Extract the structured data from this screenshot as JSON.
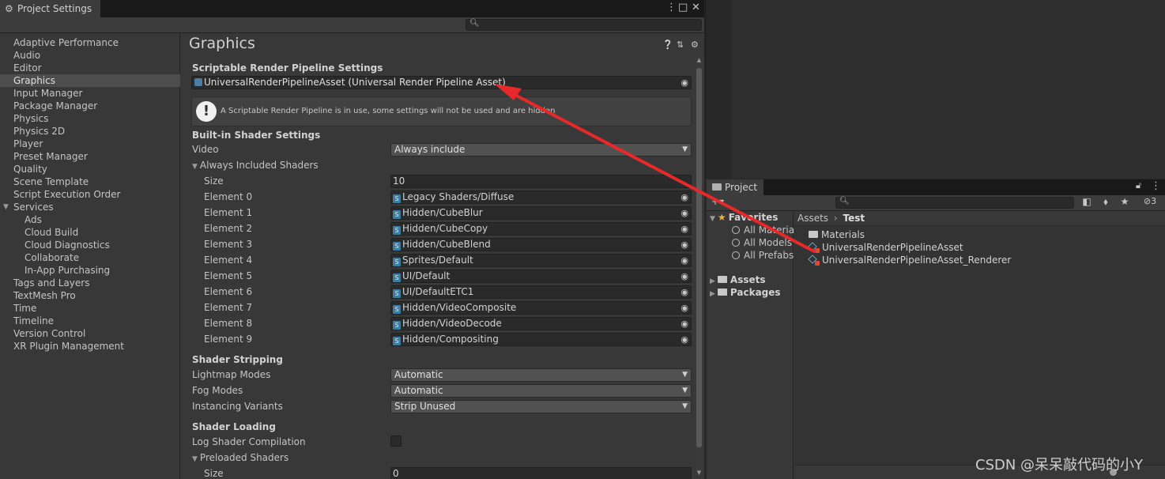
{
  "project_settings": {
    "tab_title": "Project Settings",
    "page_title": "Graphics",
    "sidebar": [
      {
        "label": "Adaptive Performance"
      },
      {
        "label": "Audio"
      },
      {
        "label": "Editor"
      },
      {
        "label": "Graphics",
        "selected": true
      },
      {
        "label": "Input Manager"
      },
      {
        "label": "Package Manager"
      },
      {
        "label": "Physics"
      },
      {
        "label": "Physics 2D"
      },
      {
        "label": "Player"
      },
      {
        "label": "Preset Manager"
      },
      {
        "label": "Quality"
      },
      {
        "label": "Scene Template"
      },
      {
        "label": "Script Execution Order"
      },
      {
        "label": "Services",
        "expandable": true
      },
      {
        "label": "Ads",
        "child": true
      },
      {
        "label": "Cloud Build",
        "child": true
      },
      {
        "label": "Cloud Diagnostics",
        "child": true
      },
      {
        "label": "Collaborate",
        "child": true
      },
      {
        "label": "In-App Purchasing",
        "child": true
      },
      {
        "label": "Tags and Layers"
      },
      {
        "label": "TextMesh Pro"
      },
      {
        "label": "Time"
      },
      {
        "label": "Timeline"
      },
      {
        "label": "Version Control"
      },
      {
        "label": "XR Plugin Management"
      }
    ],
    "srp": {
      "section": "Scriptable Render Pipeline Settings",
      "asset_value": "UniversalRenderPipelineAsset (Universal Render Pipeline Asset)",
      "help_text": "A Scriptable Render Pipeline is in use, some settings will not be used and are hidden"
    },
    "builtin": {
      "section": "Built-in Shader Settings",
      "video_label": "Video",
      "video_value": "Always include",
      "always_included_label": "Always Included Shaders",
      "size_label": "Size",
      "size_value": "10",
      "elements": [
        {
          "label": "Element 0",
          "value": "Legacy Shaders/Diffuse"
        },
        {
          "label": "Element 1",
          "value": "Hidden/CubeBlur"
        },
        {
          "label": "Element 2",
          "value": "Hidden/CubeCopy"
        },
        {
          "label": "Element 3",
          "value": "Hidden/CubeBlend"
        },
        {
          "label": "Element 4",
          "value": "Sprites/Default"
        },
        {
          "label": "Element 5",
          "value": "UI/Default"
        },
        {
          "label": "Element 6",
          "value": "UI/DefaultETC1"
        },
        {
          "label": "Element 7",
          "value": "Hidden/VideoComposite"
        },
        {
          "label": "Element 8",
          "value": "Hidden/VideoDecode"
        },
        {
          "label": "Element 9",
          "value": "Hidden/Compositing"
        }
      ]
    },
    "stripping": {
      "section": "Shader Stripping",
      "lightmap_label": "Lightmap Modes",
      "lightmap_value": "Automatic",
      "fog_label": "Fog Modes",
      "fog_value": "Automatic",
      "instancing_label": "Instancing Variants",
      "instancing_value": "Strip Unused"
    },
    "loading": {
      "section": "Shader Loading",
      "log_label": "Log Shader Compilation",
      "log_checked": false,
      "preloaded_label": "Preloaded Shaders",
      "size_label": "Size",
      "size_value": "0"
    }
  },
  "project_window": {
    "tab_title": "Project",
    "hidden_count": "3",
    "tree": {
      "favorites": "Favorites",
      "fav_items": [
        "All Materia",
        "All Models",
        "All Prefabs"
      ],
      "assets": "Assets",
      "packages": "Packages"
    },
    "breadcrumb": {
      "root": "Assets",
      "current": "Test"
    },
    "files": [
      {
        "name": "Materials",
        "icon": "folder-icon"
      },
      {
        "name": "UniversalRenderPipelineAsset",
        "icon": "urp-asset-icon"
      },
      {
        "name": "UniversalRenderPipelineAsset_Renderer",
        "icon": "urp-asset-icon"
      }
    ]
  },
  "annotation": {
    "arrow_color": "#e8292a"
  },
  "watermark": "CSDN @呆呆敲代码的小Y"
}
